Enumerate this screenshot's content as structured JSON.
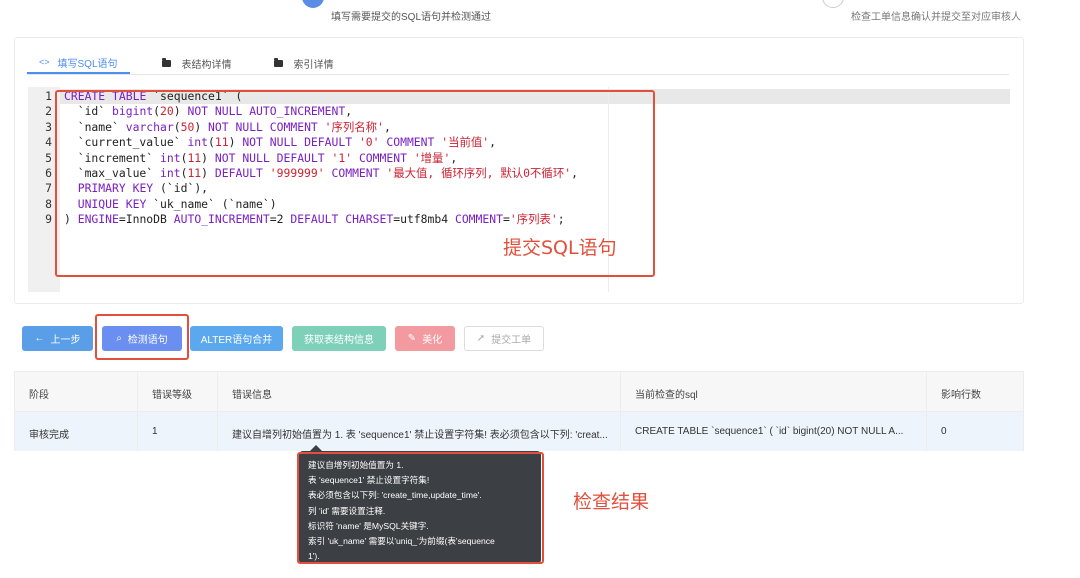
{
  "steps": {
    "left_desc": "填写需要提交的SQL语句并检测通过",
    "right_desc": "检查工单信息确认并提交至对应审核人"
  },
  "tabs": [
    {
      "label": "填写SQL语句",
      "icon": "code-icon",
      "active": true
    },
    {
      "label": "表结构详情",
      "icon": "folder-icon",
      "active": false
    },
    {
      "label": "索引详情",
      "icon": "folder-icon",
      "active": false
    }
  ],
  "editor": {
    "lines": [
      {
        "n": "1",
        "code": "CREATE TABLE `sequence1` ("
      },
      {
        "n": "2",
        "code": "  `id` bigint(20) NOT NULL AUTO_INCREMENT,"
      },
      {
        "n": "3",
        "code": "  `name` varchar(50) NOT NULL COMMENT '序列名称',"
      },
      {
        "n": "4",
        "code": "  `current_value` int(11) NOT NULL DEFAULT '0' COMMENT '当前值',"
      },
      {
        "n": "5",
        "code": "  `increment` int(11) NOT NULL DEFAULT '1' COMMENT '增量',"
      },
      {
        "n": "6",
        "code": "  `max_value` int(11) DEFAULT '999999' COMMENT '最大值, 循环序列, 默认0不循环',"
      },
      {
        "n": "7",
        "code": "  PRIMARY KEY (`id`),"
      },
      {
        "n": "8",
        "code": "  UNIQUE KEY `uk_name` (`name`)"
      },
      {
        "n": "9",
        "code": ") ENGINE=InnoDB AUTO_INCREMENT=2 DEFAULT CHARSET=utf8mb4 COMMENT='序列表';"
      }
    ]
  },
  "annotations": {
    "submit_sql": "提交SQL语句",
    "check_result": "检查结果"
  },
  "buttons": {
    "prev": "上一步",
    "check": "检测语句",
    "alter_merge": "ALTER语句合并",
    "get_schema": "获取表结构信息",
    "beautify": "美化",
    "submit": "提交工单"
  },
  "colors": {
    "prev": "#5a9ee8",
    "check": "#6a8ff0",
    "alter": "#5ba8ee",
    "schema": "#7fd0b8",
    "beautify": "#f29aa0",
    "submit": "#dcdcdc",
    "annotation": "#e0503c"
  },
  "table": {
    "headers": [
      "阶段",
      "错误等级",
      "错误信息",
      "当前检查的sql",
      "影响行数"
    ],
    "row": [
      "审核完成",
      "1",
      "建议自增列初始值置为 1. 表 'sequence1' 禁止设置字符集! 表必须包含以下列: 'creat...",
      "CREATE TABLE `sequence1` ( `id` bigint(20) NOT NULL A...",
      "0"
    ]
  },
  "tooltip": {
    "lines": [
      "建议自增列初始值置为 1.",
      "表 'sequence1' 禁止设置字符集!",
      "表必须包含以下列: 'create_time,update_time'.",
      "列 'id' 需要设置注释.",
      "标识符 'name' 是MySQL关键字.",
      "索引 'uk_name' 需要以'uniq_'为前缀(表'sequence",
      "1')."
    ]
  }
}
